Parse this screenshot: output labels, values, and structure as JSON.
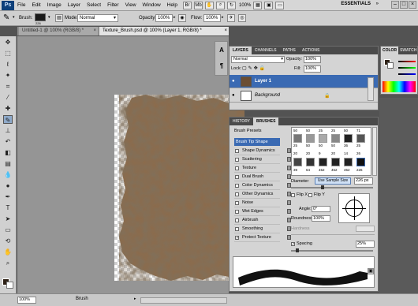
{
  "menubar": {
    "logo": "Ps",
    "items": [
      "File",
      "Edit",
      "Image",
      "Layer",
      "Select",
      "Filter",
      "View",
      "Window",
      "Help"
    ],
    "zoom": "100%",
    "workspace": "ESSENTIALS",
    "cs_live": "CS Live"
  },
  "options": {
    "brush_label": "Brush:",
    "brush_size": "226",
    "mode_label": "Mode:",
    "mode_value": "Normal",
    "opacity_label": "Opacity:",
    "opacity_value": "100%",
    "flow_label": "Flow:",
    "flow_value": "100%"
  },
  "tabs": [
    {
      "label": "Untitled-1 @ 100% (RGB/8) *"
    },
    {
      "label": "Texture_Brush.psd @ 100% (Layer 1, RGB/8) *"
    }
  ],
  "layers_panel": {
    "tabs": [
      "LAYERS",
      "CHANNELS",
      "PATHS",
      "ACTIONS"
    ],
    "blend_mode": "Normal",
    "opacity_label": "Opacity:",
    "opacity_value": "100%",
    "lock_label": "Lock:",
    "fill_label": "Fill:",
    "fill_value": "100%",
    "layers": [
      {
        "name": "Layer 1",
        "selected": true
      },
      {
        "name": "Background",
        "selected": false
      }
    ]
  },
  "brush_panel": {
    "tabs": [
      "HISTORY",
      "BRUSHES"
    ],
    "presets_label": "Brush Presets",
    "tip_shape_label": "Brush Tip Shape",
    "options": [
      {
        "label": "Shape Dynamics",
        "checked": false
      },
      {
        "label": "Scattering",
        "checked": false
      },
      {
        "label": "Texture",
        "checked": false
      },
      {
        "label": "Dual Brush",
        "checked": false
      },
      {
        "label": "Color Dynamics",
        "checked": false
      },
      {
        "label": "Other Dynamics",
        "checked": false
      },
      {
        "label": "Noise",
        "checked": false
      },
      {
        "label": "Wet Edges",
        "checked": false
      },
      {
        "label": "Airbrush",
        "checked": false
      },
      {
        "label": "Smoothing",
        "checked": false
      },
      {
        "label": "Protect Texture",
        "checked": true
      }
    ],
    "tip_sizes_row1": [
      "50",
      "50",
      "25",
      "25",
      "50",
      "71"
    ],
    "tip_sizes_row2": [
      "25",
      "50",
      "50",
      "50",
      "36",
      "25"
    ],
    "tip_sizes_row3": [
      "20",
      "20",
      "9",
      "20",
      "14",
      "26"
    ],
    "tip_sizes_row4": [
      "39",
      "64",
      "452",
      "452",
      "452",
      "226"
    ],
    "diameter_label": "Diameter",
    "use_sample_size": "Use Sample Size",
    "diameter_value": "226 px",
    "flip_x": "Flip X",
    "flip_y": "Flip Y",
    "angle_label": "Angle:",
    "angle_value": "0°",
    "roundness_label": "Roundness:",
    "roundness_value": "100%",
    "hardness_label": "Hardness",
    "spacing_label": "Spacing",
    "spacing_value": "25%"
  },
  "color_panel": {
    "tabs": [
      "COLOR",
      "SWATCH"
    ]
  },
  "status": {
    "zoom": "100%",
    "tool": "Brush"
  }
}
